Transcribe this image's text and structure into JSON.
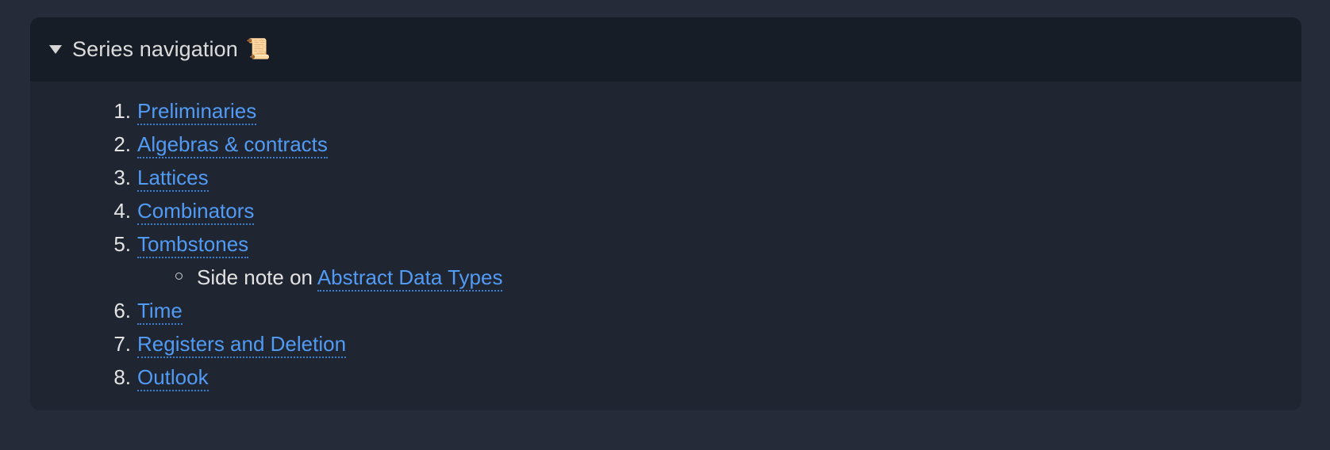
{
  "card": {
    "title": "Series navigation",
    "title_emoji": "📜",
    "emoji_name": "scroll-emoji",
    "expanded": true,
    "disclosure_icon": "triangle-down-icon",
    "colors": {
      "page_background": "#252b38",
      "card_background": "#1f2531",
      "header_background": "#171d27",
      "link": "#529bf5",
      "text": "#e3e3e3"
    }
  },
  "series_items": [
    {
      "number": "1.",
      "label": "Preliminaries",
      "is_link": true
    },
    {
      "number": "2.",
      "label": "Algebras & contracts",
      "is_link": true
    },
    {
      "number": "3.",
      "label": "Lattices",
      "is_link": true
    },
    {
      "number": "4.",
      "label": "Combinators",
      "is_link": true
    },
    {
      "number": "5.",
      "label": "Tombstones",
      "is_link": true
    },
    {
      "number": "6.",
      "label": "Time",
      "is_link": true
    },
    {
      "number": "7.",
      "label": "Registers and Deletion",
      "is_link": true
    },
    {
      "number": "8.",
      "label": "Outlook",
      "is_link": true
    }
  ],
  "side_note": {
    "after_item": 5,
    "prefix_text": "Side note on ",
    "link_label": "Abstract Data Types",
    "bullet": "circle-outline-bullet"
  }
}
